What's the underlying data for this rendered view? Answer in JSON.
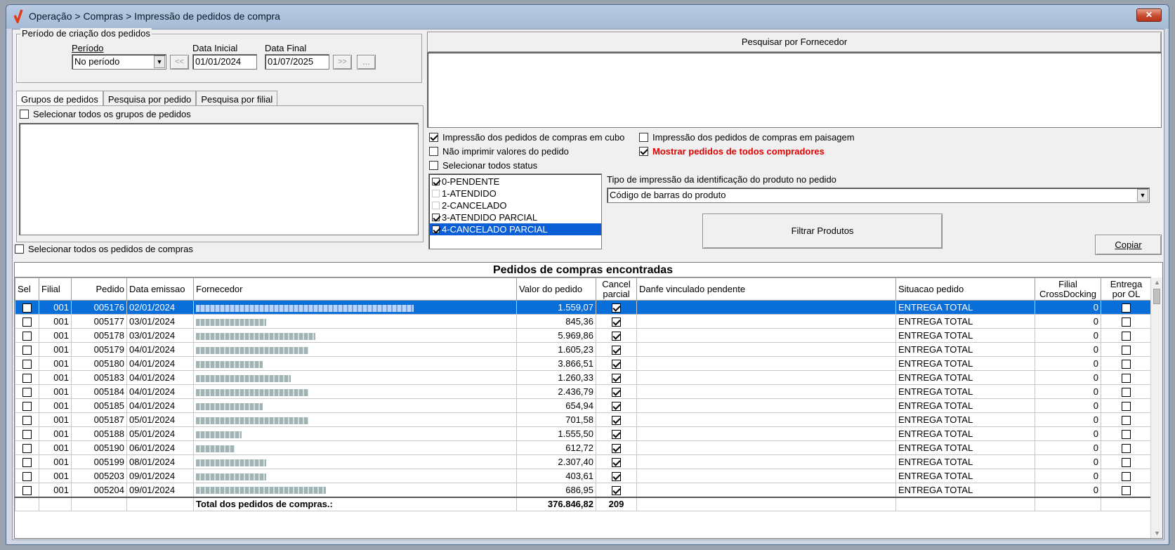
{
  "window": {
    "title": "Operação > Compras > Impressão de pedidos de compra",
    "close_label": "✕"
  },
  "periodo_group": {
    "title": "Período de criação dos pedidos",
    "periodo_label": "Período",
    "periodo_value": "No período",
    "data_inicial_label": "Data Inicial",
    "data_inicial_value": "01/01/2024",
    "data_final_label": "Data Final",
    "data_final_value": "01/07/2025",
    "prev_label": "<<",
    "next_label": ">>",
    "more_label": "..."
  },
  "tabs": [
    "Grupos de pedidos",
    "Pesquisa por pedido",
    "Pesquisa por filial"
  ],
  "select_all_groups": "Selecionar todos os grupos de pedidos",
  "select_all_orders": "Selecionar todos os pedidos de compras",
  "supplier_search": {
    "label": "Pesquisar por Fornecedor"
  },
  "options": {
    "cubo": "Impressão dos pedidos de compras em cubo",
    "paisagem": "Impressão dos pedidos de compras em paisagem",
    "nao_imprimir": "Não imprimir valores do pedido",
    "todos_compradores": "Mostrar pedidos de todos compradores",
    "todos_status": "Selecionar todos status"
  },
  "status_list": [
    {
      "label": "0-PENDENTE",
      "checked": true
    },
    {
      "label": "1-ATENDIDO",
      "checked": false
    },
    {
      "label": "2-CANCELADO",
      "checked": false
    },
    {
      "label": "3-ATENDIDO PARCIAL",
      "checked": true
    },
    {
      "label": "4-CANCELADO PARCIAL",
      "checked": true
    }
  ],
  "tipo_impressao": {
    "label": "Tipo de impressão da identificação do produto no pedido",
    "value": "Código de barras do produto"
  },
  "buttons": {
    "filtrar": "Filtrar Produtos",
    "copiar": "Copiar"
  },
  "grid": {
    "title": "Pedidos de compras encontradas",
    "columns": [
      "Sel",
      "Filial",
      "Pedido",
      "Data emissao",
      "Fornecedor",
      "Valor do pedido",
      "Cancel parcial",
      "Danfe vinculado pendente",
      "Situacao pedido",
      "Filial CrossDocking",
      "Entrega por OL"
    ],
    "rows": [
      {
        "filial": "001",
        "pedido": "005176",
        "data": "02/01/2024",
        "valor": "1.559,07",
        "situacao": "ENTREGA TOTAL",
        "crossdocking": "0"
      },
      {
        "filial": "001",
        "pedido": "005177",
        "data": "03/01/2024",
        "valor": "845,36",
        "situacao": "ENTREGA TOTAL",
        "crossdocking": "0"
      },
      {
        "filial": "001",
        "pedido": "005178",
        "data": "03/01/2024",
        "valor": "5.969,86",
        "situacao": "ENTREGA TOTAL",
        "crossdocking": "0"
      },
      {
        "filial": "001",
        "pedido": "005179",
        "data": "04/01/2024",
        "valor": "1.605,23",
        "situacao": "ENTREGA TOTAL",
        "crossdocking": "0"
      },
      {
        "filial": "001",
        "pedido": "005180",
        "data": "04/01/2024",
        "valor": "3.866,51",
        "situacao": "ENTREGA TOTAL",
        "crossdocking": "0"
      },
      {
        "filial": "001",
        "pedido": "005183",
        "data": "04/01/2024",
        "valor": "1.260,33",
        "situacao": "ENTREGA TOTAL",
        "crossdocking": "0"
      },
      {
        "filial": "001",
        "pedido": "005184",
        "data": "04/01/2024",
        "valor": "2.436,79",
        "situacao": "ENTREGA TOTAL",
        "crossdocking": "0"
      },
      {
        "filial": "001",
        "pedido": "005185",
        "data": "04/01/2024",
        "valor": "654,94",
        "situacao": "ENTREGA TOTAL",
        "crossdocking": "0"
      },
      {
        "filial": "001",
        "pedido": "005187",
        "data": "05/01/2024",
        "valor": "701,58",
        "situacao": "ENTREGA TOTAL",
        "crossdocking": "0"
      },
      {
        "filial": "001",
        "pedido": "005188",
        "data": "05/01/2024",
        "valor": "1.555,50",
        "situacao": "ENTREGA TOTAL",
        "crossdocking": "0"
      },
      {
        "filial": "001",
        "pedido": "005190",
        "data": "06/01/2024",
        "valor": "612,72",
        "situacao": "ENTREGA TOTAL",
        "crossdocking": "0"
      },
      {
        "filial": "001",
        "pedido": "005199",
        "data": "08/01/2024",
        "valor": "2.307,40",
        "situacao": "ENTREGA TOTAL",
        "crossdocking": "0"
      },
      {
        "filial": "001",
        "pedido": "005203",
        "data": "09/01/2024",
        "valor": "403,61",
        "situacao": "ENTREGA TOTAL",
        "crossdocking": "0"
      },
      {
        "filial": "001",
        "pedido": "005204",
        "data": "09/01/2024",
        "valor": "686,95",
        "situacao": "ENTREGA TOTAL",
        "crossdocking": "0"
      }
    ],
    "total_label": "Total dos pedidos de compras.:",
    "total_value": "376.846,82",
    "total_count": "209"
  },
  "colors": {
    "selection": "#0a6ed8",
    "red_option": "#e00000",
    "title_bar": "#a6bbd6"
  }
}
